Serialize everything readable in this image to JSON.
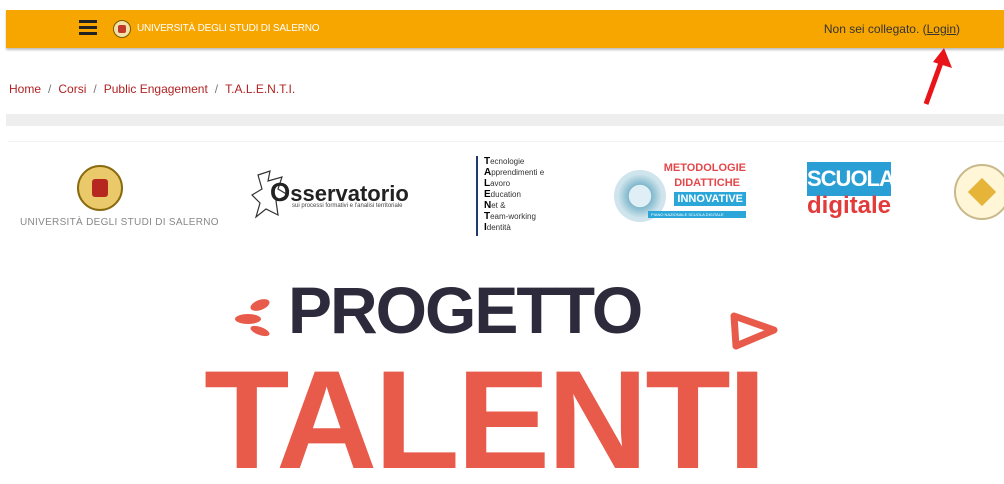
{
  "header": {
    "site_name": "UNIVERSITÀ DEGLI STUDI DI SALERNO",
    "login_status": "Non sei collegato. (",
    "login_link": "Login",
    "login_close": ")"
  },
  "breadcrumb": [
    "Home",
    "Corsi",
    "Public Engagement",
    "T.A.L.E.N.T.I."
  ],
  "logos": {
    "unisa": "UNIVERSITÀ DEGLI STUDI DI SALERNO",
    "osservatorio_title": "sservatorio",
    "osservatorio_sub": "sui processi formativi e l'analisi territoriale",
    "talenti_acronym": [
      {
        "initial": "T",
        "rest": "ecnologie"
      },
      {
        "initial": "A",
        "rest": "pprendimenti e"
      },
      {
        "initial": "L",
        "rest": "avoro"
      },
      {
        "initial": "E",
        "rest": "ducation"
      },
      {
        "initial": "N",
        "rest": "et &"
      },
      {
        "initial": "T",
        "rest": "eam-working"
      },
      {
        "initial": "I",
        "rest": "dentità"
      }
    ],
    "metodologie_1": "METODOLOGIE",
    "metodologie_2": "DIDATTICHE",
    "metodologie_3": "INNOVATIVE",
    "metodologie_4": "PIANO NAZIONALE SCUOLA DIGITALE",
    "scuola_1": "SCUOLA",
    "scuola_2": "digitale"
  },
  "poster": {
    "line1": "PROGETTO",
    "line2": "TALENTI"
  },
  "colors": {
    "header_bg": "#f7a600",
    "link": "#b22222",
    "talenti_red": "#e85a4a",
    "progetto_dark": "#2d2b3b"
  }
}
